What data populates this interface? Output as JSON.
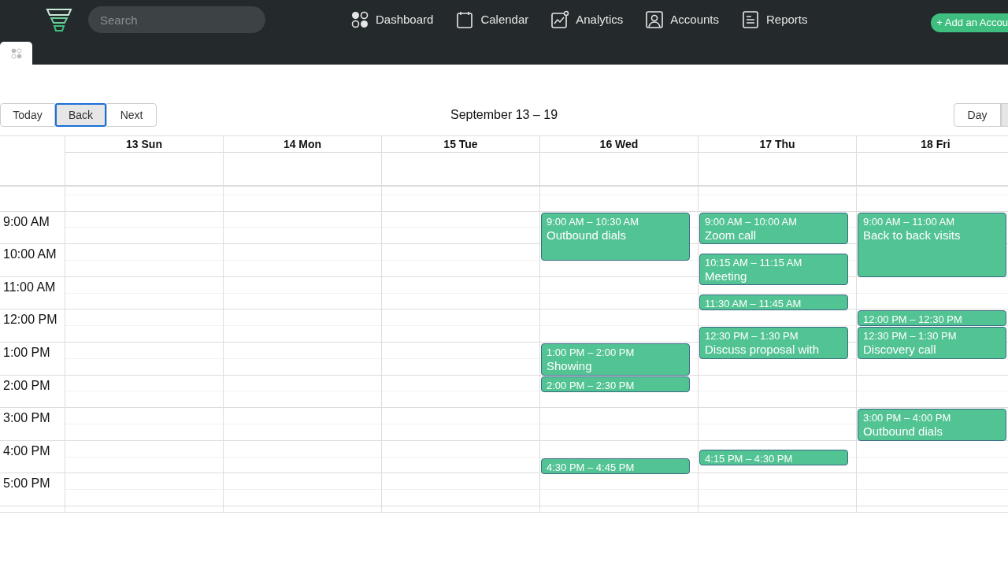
{
  "search": {
    "placeholder": "Search"
  },
  "nav": [
    {
      "label": "Dashboard",
      "kind": "dashboard"
    },
    {
      "label": "Calendar",
      "kind": "calendar"
    },
    {
      "label": "Analytics",
      "kind": "analytics"
    },
    {
      "label": "Accounts",
      "kind": "accounts"
    },
    {
      "label": "Reports",
      "kind": "reports"
    }
  ],
  "add_button": "+ Add an Accou",
  "toolbar": {
    "buttons": [
      {
        "label": "Today",
        "selected": false
      },
      {
        "label": "Back",
        "selected": true
      },
      {
        "label": "Next",
        "selected": false
      }
    ],
    "title": "September 13 – 19",
    "views": [
      {
        "label": "Day",
        "selected": false
      }
    ]
  },
  "calendar": {
    "hours": [
      "9:00 AM",
      "10:00 AM",
      "11:00 AM",
      "12:00 PM",
      "1:00 PM",
      "2:00 PM",
      "3:00 PM",
      "4:00 PM",
      "5:00 PM"
    ],
    "days": [
      {
        "label": "13 Sun"
      },
      {
        "label": "14 Mon"
      },
      {
        "label": "15 Tue"
      },
      {
        "label": "16 Wed",
        "events": [
          {
            "time": "9:00 AM – 10:30 AM",
            "title": "Outbound dials"
          },
          {
            "time": "1:00 PM – 2:00 PM",
            "title": "Showing"
          },
          {
            "time": "2:00 PM – 2:30 PM"
          },
          {
            "time": "4:30 PM – 4:45 PM"
          }
        ]
      },
      {
        "label": "17 Thu",
        "events": [
          {
            "time": "9:00 AM – 10:00 AM",
            "title": "Zoom call"
          },
          {
            "time": "10:15 AM – 11:15 AM",
            "title": "Meeting"
          },
          {
            "time": "11:30 AM – 11:45 AM"
          },
          {
            "time": "12:30 PM – 1:30 PM",
            "title": "Discuss proposal with"
          },
          {
            "time": "4:15 PM – 4:30 PM"
          }
        ]
      },
      {
        "label": "18 Fri",
        "events": [
          {
            "time": "9:00 AM – 11:00 AM",
            "title": "Back to back visits"
          },
          {
            "time": "12:00 PM – 12:30 PM"
          },
          {
            "time": "12:30 PM – 1:30 PM",
            "title": "Discovery call"
          },
          {
            "time": "3:00 PM – 4:00 PM",
            "title": "Outbound dials"
          }
        ]
      }
    ]
  }
}
